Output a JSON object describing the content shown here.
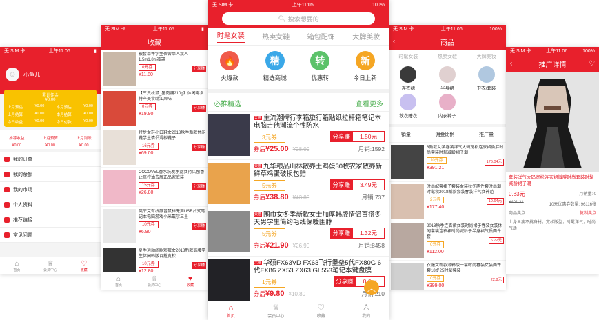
{
  "profile": {
    "status_carrier": "无 SIM 卡",
    "status_time": "上午11:06",
    "username": "小鱼儿",
    "balance_label": "累计佣金",
    "balance_value": "¥0.00",
    "rows": [
      {
        "l": "上月预估",
        "lv": "¥0.00",
        "r": "本月预估",
        "rv": "¥0.00"
      },
      {
        "l": "上月结算",
        "lv": "¥0.00",
        "r": "本月结算",
        "rv": "¥0.00"
      },
      {
        "l": "今日收益",
        "lv": "¥0.00",
        "r": "今日付款",
        "rv": "¥0.00"
      }
    ],
    "earnings": [
      {
        "label": "推荐收益",
        "value": "¥0.00"
      },
      {
        "label": "上月預算",
        "value": "¥0.00"
      },
      {
        "label": "上月到账",
        "value": "¥0.00"
      }
    ],
    "menu": [
      "我的订单",
      "我的余额",
      "我的市场",
      "个人资料",
      "推荐链接",
      "常见问题"
    ],
    "tabs": [
      "首页",
      "会员中心",
      "收藏"
    ]
  },
  "favorites": {
    "status_carrier": "无 SIM 卡",
    "status_time": "上午11:05",
    "title": "收藏",
    "items": [
      {
        "title": "被套单件学生宿舍单人双人1.5m1.8m被罩",
        "coupon": "0元券",
        "price": "¥11.80"
      },
      {
        "title": "【三只松鼠_猪肉脯210g】休闲零食特产美食靖江风味",
        "coupon": "0元券",
        "price": "¥19.90"
      },
      {
        "title": "特步女鞋小白鞋女2018秋季新款休闲鞋学生情侣滑板鞋子",
        "coupon": "16元券",
        "price": "¥69.00"
      },
      {
        "title": "COCOVEL香水洗发水露女持久留香止痒控油去屑正品家庭装",
        "coupon": "15元券",
        "price": "¥26.80"
      },
      {
        "title": "英菲克有线静音鼠标无声USB台式笔记本电脑游戏小米戴尔三星",
        "coupon": "10元券",
        "price": "¥6.90"
      },
      {
        "title": "夏季运动阔腿短裤女2018新款高腰学生休闲韩版百搭宽松",
        "coupon": "10元券",
        "price": "¥12.80"
      }
    ],
    "tabs": [
      "首页",
      "会员中心",
      "收藏"
    ]
  },
  "main": {
    "status_carrier": "无 SIM 卡",
    "status_time": "上午11:05",
    "status_battery": "100%",
    "search_placeholder": "搜索想要的",
    "tabs": [
      "时髦女装",
      "热卖女鞋",
      "箱包配饰",
      "大牌美妆"
    ],
    "cats": [
      {
        "icon": "🔥",
        "label": "火爆款",
        "color": "#f05a4a"
      },
      {
        "icon": "精",
        "label": "精选商城",
        "color": "#3aa8e8"
      },
      {
        "icon": "转",
        "label": "优惠转",
        "color": "#5cc26a"
      },
      {
        "icon": "新",
        "label": "今日上新",
        "color": "#f5a623"
      }
    ],
    "section_title": "必推精选",
    "section_more": "查看更多",
    "share_label": "分享赚",
    "price_label": "券后",
    "products": [
      {
        "tm": "天猫",
        "title": "主流潮牌行李箱旅行箱贴纸拉杆箱笔记本电脑吉他潮流个性防水",
        "coupon": "3元券",
        "share": "1.50元",
        "price": "¥25.00",
        "orig": "¥28.00",
        "sales": "月销:1592",
        "color": "#3a3a4a"
      },
      {
        "tm": "天猫",
        "title": "九华粮品山林散养土鸡蛋30枚农家散养新鲜草鸡蛋破损包赔",
        "coupon": "5元券",
        "share": "3.49元",
        "price": "¥38.80",
        "orig": "¥43.80",
        "sales": "月销:737",
        "color": "#e9a34c"
      },
      {
        "tm": "天猫",
        "title": "围巾女冬季新款女士加厚韩版情侣百搭冬天男学生简约毛线保暖围脖",
        "coupon": "5元券",
        "share": "1.32元",
        "price": "¥21.90",
        "orig": "¥26.90",
        "sales": "月销:8458",
        "color": "#8b8b8b"
      },
      {
        "tm": "天猫",
        "title": "华硕FX63VD FX63飞行堡垒5代FX80G 6代FX86 ZX53 ZX63 GL553笔记本键盘膜ZX50",
        "coupon": "1元券",
        "share": "0.6元",
        "price": "¥9.80",
        "orig": "¥10.80",
        "sales": "月销:210",
        "color": "#222226"
      }
    ],
    "tabbar": [
      "首页",
      "会员中心",
      "收藏",
      "我的"
    ]
  },
  "category": {
    "status_carrier": "无 SIM 卡",
    "status_time": "上午11:06",
    "status_battery": "100%",
    "title": "商品",
    "tabs": [
      "时髦女装",
      "热卖女鞋",
      "大牌美妆"
    ],
    "grid": [
      "连衣裙",
      "半身裙",
      "卫衣/套装",
      "秋衣睡衣",
      "内衣裤子",
      ""
    ],
    "sort": [
      "销量",
      "佣金比例",
      "推广量"
    ],
    "items": [
      {
        "title": "8新款女装春装洋气大码宽松连衣裙微胖时尚套装时髦减龄裙子潮",
        "coupon": "10元券",
        "price": "¥391.21",
        "share": "176.04元"
      },
      {
        "title": "时尚配套裙子套装女装秋冬两件套时尚潮时髦秋2018新款套装春装洋气女神范",
        "coupon": "2元券",
        "price": "¥177.40",
        "share": "10.64元"
      },
      {
        "title": "2018秋季连衣裙女装时尚裙子春装女装休闲套装连衣裙时尚减龄子半身裙气质两件套",
        "coupon": "0元券",
        "price": "¥112.00",
        "share": "6.72元"
      },
      {
        "title": "衣服女新款潮韩版一套时尚春装女装两件套18岁25时髦套装",
        "coupon": "0元券",
        "price": "¥399.00",
        "share": "22.8元"
      }
    ]
  },
  "detail": {
    "status_carrier": "无 SIM 卡",
    "status_time": "上午11:06",
    "status_battery": "100%",
    "title": "推广详情",
    "product_title": "套装洋气大码宽松连衣裙微胖时尚套装时髦减龄裙子潮",
    "price": "0.83元",
    "sales": "月销量: 0",
    "orig": "¥401.21",
    "coupon_info": "10元优惠券数量: 96116张",
    "section": "商品卖点",
    "copy": "复制卖点",
    "desc": "上身显瘦不挑身材，宽松版型，时髦洋气，时尚气质"
  }
}
